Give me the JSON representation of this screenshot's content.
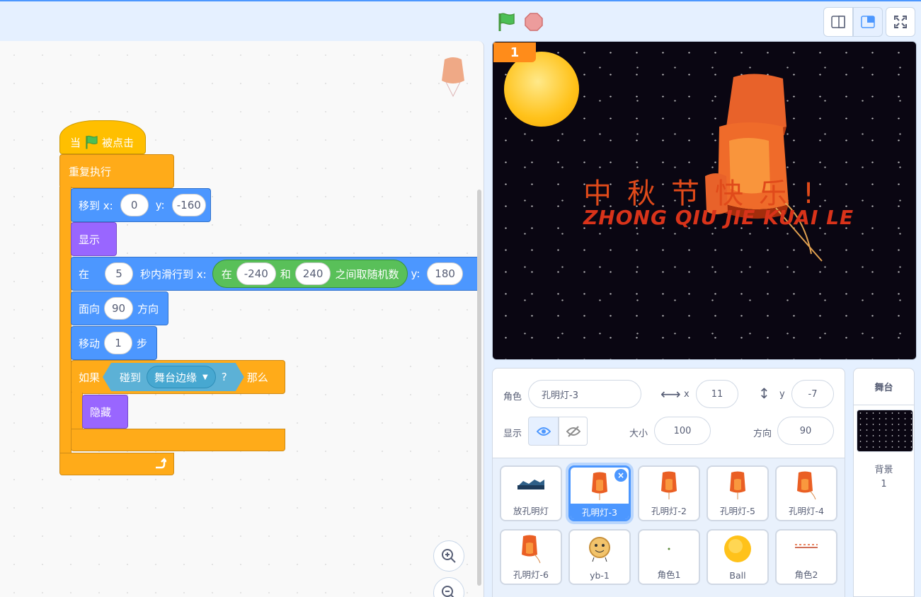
{
  "toolbar": {
    "green_flag": "green-flag-icon",
    "stop": "stop-icon",
    "small_stage": "small-stage-icon",
    "large_stage": "large-stage-icon",
    "fullscreen": "fullscreen-icon"
  },
  "script": {
    "hat_when": "当",
    "hat_clicked": "被点击",
    "forever": "重复执行",
    "goto_label": "移到 x:",
    "goto_x": "0",
    "goto_y_label": "y:",
    "goto_y": "-160",
    "show": "显示",
    "glide_in": "在",
    "glide_secs": "5",
    "glide_label": "秒内滑行到 x:",
    "random_in": "在",
    "random_from": "-240",
    "random_and": "和",
    "random_to": "240",
    "random_label": "之间取随机数",
    "glide_y_label": "y:",
    "glide_y": "180",
    "point_label": "面向",
    "point_value": "90",
    "point_suffix": "方向",
    "move_label": "移动",
    "move_value": "1",
    "move_suffix": "步",
    "if_label": "如果",
    "touching_label": "碰到",
    "touching_target": "舞台边缘",
    "touching_q": "?",
    "then_label": "那么",
    "hide": "隐藏"
  },
  "stage": {
    "badge": "1",
    "greeting": "中秋节快乐!",
    "pinyin": "ZHONG QIU JIE KUAI LE"
  },
  "sprite_info": {
    "sprite_label": "角色",
    "sprite_name": "孔明灯-3",
    "x_label": "x",
    "x_value": "11",
    "y_label": "y",
    "y_value": "-7",
    "show_label": "显示",
    "size_label": "大小",
    "size_value": "100",
    "direction_label": "方向",
    "direction_value": "90"
  },
  "sprites": [
    {
      "name": "放孔明灯",
      "thumb": "scene"
    },
    {
      "name": "孔明灯-3",
      "thumb": "lantern",
      "selected": true
    },
    {
      "name": "孔明灯-2",
      "thumb": "lantern"
    },
    {
      "name": "孔明灯-5",
      "thumb": "lantern"
    },
    {
      "name": "孔明灯-4",
      "thumb": "lantern"
    },
    {
      "name": "孔明灯-6",
      "thumb": "lantern"
    },
    {
      "name": "yb-1",
      "thumb": "mooncake"
    },
    {
      "name": "角色1",
      "thumb": "dot"
    },
    {
      "name": "Ball",
      "thumb": "ball"
    },
    {
      "name": "角色2",
      "thumb": "dots"
    }
  ],
  "stage_panel": {
    "title": "舞台",
    "backdrop_label": "背景",
    "backdrop_count": "1"
  },
  "colors": {
    "motion": "#4c97ff",
    "looks": "#9966ff",
    "control": "#ffab19",
    "events": "#ffbf00",
    "operators": "#59c059",
    "sensing": "#5cb1d6"
  }
}
